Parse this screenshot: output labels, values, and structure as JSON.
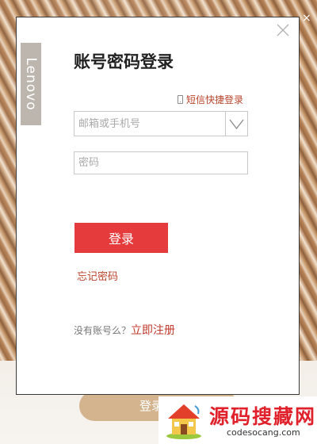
{
  "background": {
    "cta_partial_label": "登录",
    "close_glyph": "×"
  },
  "dialog": {
    "brand": "Lenovo",
    "title": "账号密码登录",
    "sms_login": {
      "icon": "phone-icon",
      "label": "短信快捷登录"
    },
    "account": {
      "value": "",
      "placeholder": "邮箱或手机号",
      "dropdown_icon": "chevron-down-icon"
    },
    "password": {
      "value": "",
      "placeholder": "密码"
    },
    "login_button": "登录",
    "forgot_password": "忘记密码",
    "register": {
      "prompt": "没有账号么？",
      "link": "立即注册"
    },
    "close_icon": "close-icon"
  },
  "watermark": {
    "title": "源码搜藏网",
    "url": "codesocang.com"
  },
  "colors": {
    "accent": "#e63b3d",
    "link": "#b8432a",
    "brand_bar": "#bdb6ae",
    "watermark_red": "#e0202a"
  }
}
